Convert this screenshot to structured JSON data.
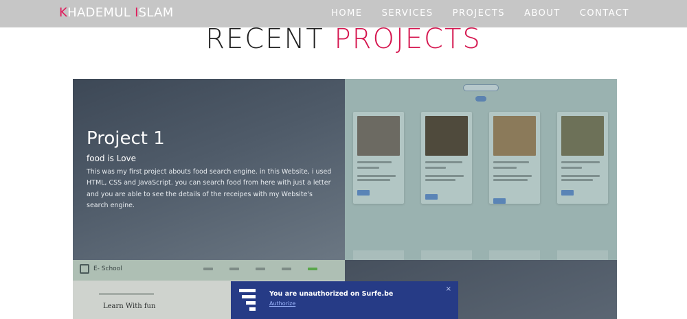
{
  "brand": {
    "first_initial": "K",
    "first_rest": "HADEMUL",
    "last_initial": "I",
    "last_rest": "SLAM"
  },
  "nav": {
    "items": [
      {
        "label": "HOME"
      },
      {
        "label": "SERVICES"
      },
      {
        "label": "PROJECTS"
      },
      {
        "label": "ABOUT"
      },
      {
        "label": "CONTACT"
      }
    ]
  },
  "section": {
    "title_plain": "RECENT",
    "title_accent": "PROJECTS"
  },
  "projects": [
    {
      "name": "Project 1",
      "subtitle": "food is Love",
      "description": "This was my first project abouts food search engine. in this Website, i used HTML, CSS and JavaScript. you can search food from here with just a letter and you are able to see the details of the receipes with my Website's search engine."
    }
  ],
  "e_school": {
    "name": "E- School",
    "heading": "Learn With fun"
  },
  "notification": {
    "message": "You are unauthorized on Surfe.be",
    "link_label": "Authorize",
    "close_glyph": "×"
  },
  "colors": {
    "accent": "#e0195a",
    "navbar": "#c6c6c6",
    "toast_bg": "#263b86"
  }
}
